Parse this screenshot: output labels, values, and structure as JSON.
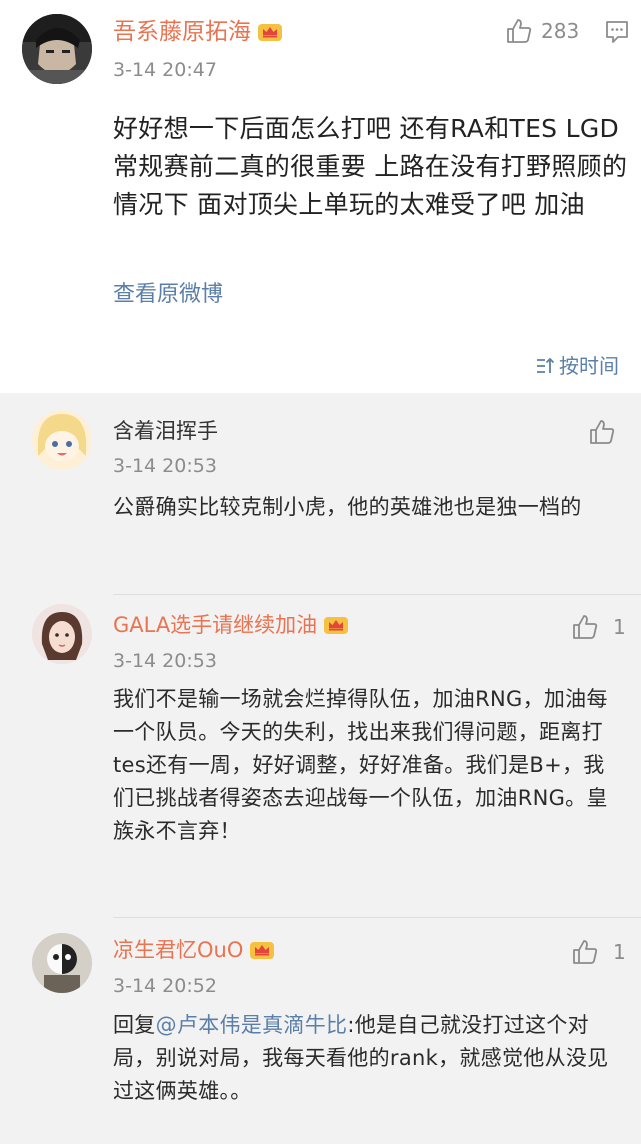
{
  "post": {
    "username": "吾系藤原拓海",
    "time": "3-14 20:47",
    "like_count": "283",
    "text": "好好想一下后面怎么打吧 还有RA和TES LGD 常规赛前二真的很重要 上路在没有打野照顾的情况下 面对顶尖上单玩的太难受了吧 加油",
    "view_original": "查看原微博",
    "sort_label": "按时间",
    "icons": [
      "avatar",
      "crown-badge-icon",
      "thumbs-up-icon",
      "comment-icon",
      "sort-icon"
    ]
  },
  "comments": [
    {
      "username": "含着泪挥手",
      "time": "3-14 20:53",
      "like_count": "",
      "text": "公爵确实比较克制小虎，他的英雄池也是独一档的"
    },
    {
      "username": "GALA选手请继续加油",
      "time": "3-14 20:53",
      "like_count": "1",
      "text": "我们不是输一场就会烂掉得队伍，加油RNG，加油每一个队员。今天的失利，找出来我们得问题，距离打tes还有一周，好好调整，好好准备。我们是B+，我们已挑战者得姿态去迎战每一个队伍，加油RNG。皇族永不言弃！"
    },
    {
      "username": "凉生君忆OuO",
      "time": "3-14 20:52",
      "like_count": "1",
      "reply_prefix": "回复",
      "reply_mention": "@卢本伟是真滴牛比",
      "text": ":他是自己就没打过这个对局，别说对局，我每天看他的rank，就感觉他从没见过这俩英雄。。"
    }
  ],
  "colors": {
    "username": "#eb7350",
    "link": "#5b7fa8",
    "meta": "#8c8c8c",
    "background": "#f2f2f2"
  }
}
